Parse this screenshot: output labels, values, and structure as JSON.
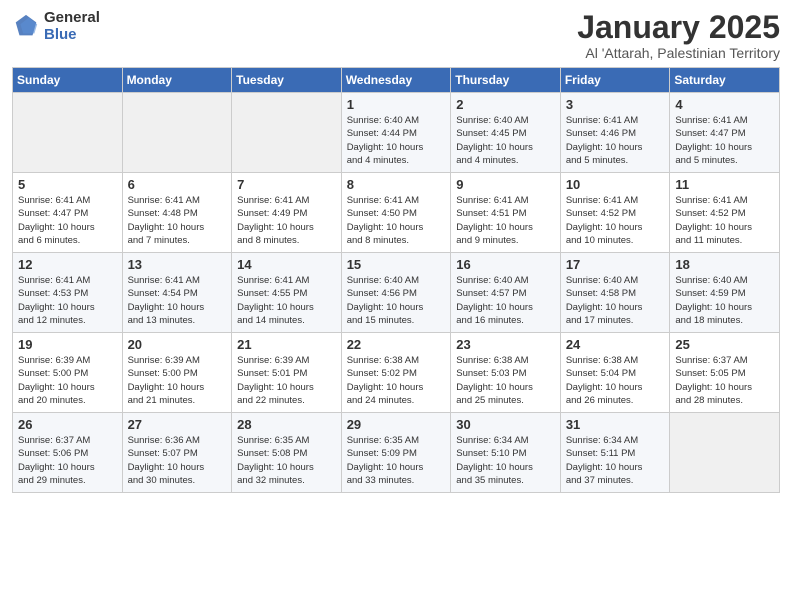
{
  "header": {
    "logo_general": "General",
    "logo_blue": "Blue",
    "title": "January 2025",
    "subtitle": "Al 'Attarah, Palestinian Territory"
  },
  "days_of_week": [
    "Sunday",
    "Monday",
    "Tuesday",
    "Wednesday",
    "Thursday",
    "Friday",
    "Saturday"
  ],
  "weeks": [
    [
      {
        "day": "",
        "info": ""
      },
      {
        "day": "",
        "info": ""
      },
      {
        "day": "",
        "info": ""
      },
      {
        "day": "1",
        "info": "Sunrise: 6:40 AM\nSunset: 4:44 PM\nDaylight: 10 hours\nand 4 minutes."
      },
      {
        "day": "2",
        "info": "Sunrise: 6:40 AM\nSunset: 4:45 PM\nDaylight: 10 hours\nand 4 minutes."
      },
      {
        "day": "3",
        "info": "Sunrise: 6:41 AM\nSunset: 4:46 PM\nDaylight: 10 hours\nand 5 minutes."
      },
      {
        "day": "4",
        "info": "Sunrise: 6:41 AM\nSunset: 4:47 PM\nDaylight: 10 hours\nand 5 minutes."
      }
    ],
    [
      {
        "day": "5",
        "info": "Sunrise: 6:41 AM\nSunset: 4:47 PM\nDaylight: 10 hours\nand 6 minutes."
      },
      {
        "day": "6",
        "info": "Sunrise: 6:41 AM\nSunset: 4:48 PM\nDaylight: 10 hours\nand 7 minutes."
      },
      {
        "day": "7",
        "info": "Sunrise: 6:41 AM\nSunset: 4:49 PM\nDaylight: 10 hours\nand 8 minutes."
      },
      {
        "day": "8",
        "info": "Sunrise: 6:41 AM\nSunset: 4:50 PM\nDaylight: 10 hours\nand 8 minutes."
      },
      {
        "day": "9",
        "info": "Sunrise: 6:41 AM\nSunset: 4:51 PM\nDaylight: 10 hours\nand 9 minutes."
      },
      {
        "day": "10",
        "info": "Sunrise: 6:41 AM\nSunset: 4:52 PM\nDaylight: 10 hours\nand 10 minutes."
      },
      {
        "day": "11",
        "info": "Sunrise: 6:41 AM\nSunset: 4:52 PM\nDaylight: 10 hours\nand 11 minutes."
      }
    ],
    [
      {
        "day": "12",
        "info": "Sunrise: 6:41 AM\nSunset: 4:53 PM\nDaylight: 10 hours\nand 12 minutes."
      },
      {
        "day": "13",
        "info": "Sunrise: 6:41 AM\nSunset: 4:54 PM\nDaylight: 10 hours\nand 13 minutes."
      },
      {
        "day": "14",
        "info": "Sunrise: 6:41 AM\nSunset: 4:55 PM\nDaylight: 10 hours\nand 14 minutes."
      },
      {
        "day": "15",
        "info": "Sunrise: 6:40 AM\nSunset: 4:56 PM\nDaylight: 10 hours\nand 15 minutes."
      },
      {
        "day": "16",
        "info": "Sunrise: 6:40 AM\nSunset: 4:57 PM\nDaylight: 10 hours\nand 16 minutes."
      },
      {
        "day": "17",
        "info": "Sunrise: 6:40 AM\nSunset: 4:58 PM\nDaylight: 10 hours\nand 17 minutes."
      },
      {
        "day": "18",
        "info": "Sunrise: 6:40 AM\nSunset: 4:59 PM\nDaylight: 10 hours\nand 18 minutes."
      }
    ],
    [
      {
        "day": "19",
        "info": "Sunrise: 6:39 AM\nSunset: 5:00 PM\nDaylight: 10 hours\nand 20 minutes."
      },
      {
        "day": "20",
        "info": "Sunrise: 6:39 AM\nSunset: 5:00 PM\nDaylight: 10 hours\nand 21 minutes."
      },
      {
        "day": "21",
        "info": "Sunrise: 6:39 AM\nSunset: 5:01 PM\nDaylight: 10 hours\nand 22 minutes."
      },
      {
        "day": "22",
        "info": "Sunrise: 6:38 AM\nSunset: 5:02 PM\nDaylight: 10 hours\nand 24 minutes."
      },
      {
        "day": "23",
        "info": "Sunrise: 6:38 AM\nSunset: 5:03 PM\nDaylight: 10 hours\nand 25 minutes."
      },
      {
        "day": "24",
        "info": "Sunrise: 6:38 AM\nSunset: 5:04 PM\nDaylight: 10 hours\nand 26 minutes."
      },
      {
        "day": "25",
        "info": "Sunrise: 6:37 AM\nSunset: 5:05 PM\nDaylight: 10 hours\nand 28 minutes."
      }
    ],
    [
      {
        "day": "26",
        "info": "Sunrise: 6:37 AM\nSunset: 5:06 PM\nDaylight: 10 hours\nand 29 minutes."
      },
      {
        "day": "27",
        "info": "Sunrise: 6:36 AM\nSunset: 5:07 PM\nDaylight: 10 hours\nand 30 minutes."
      },
      {
        "day": "28",
        "info": "Sunrise: 6:35 AM\nSunset: 5:08 PM\nDaylight: 10 hours\nand 32 minutes."
      },
      {
        "day": "29",
        "info": "Sunrise: 6:35 AM\nSunset: 5:09 PM\nDaylight: 10 hours\nand 33 minutes."
      },
      {
        "day": "30",
        "info": "Sunrise: 6:34 AM\nSunset: 5:10 PM\nDaylight: 10 hours\nand 35 minutes."
      },
      {
        "day": "31",
        "info": "Sunrise: 6:34 AM\nSunset: 5:11 PM\nDaylight: 10 hours\nand 37 minutes."
      },
      {
        "day": "",
        "info": ""
      }
    ]
  ]
}
